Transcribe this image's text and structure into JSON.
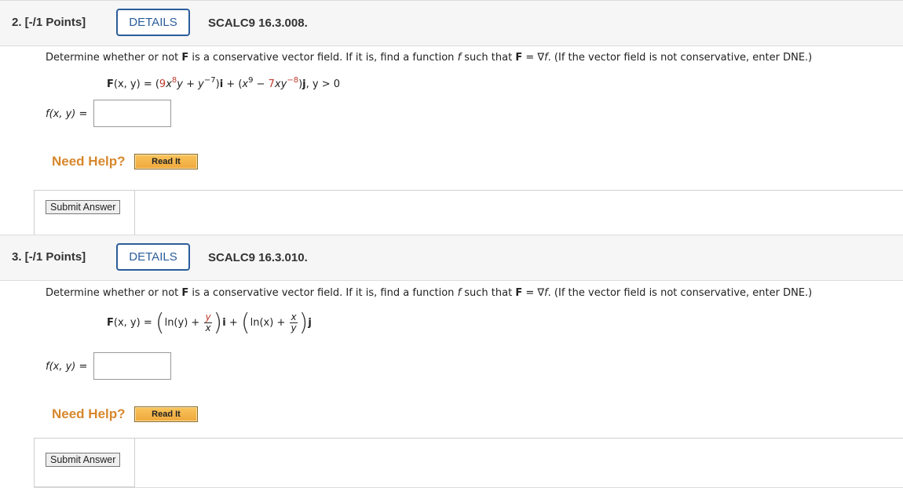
{
  "q2": {
    "num": "2.  [-/1 Points]",
    "details": "DETAILS",
    "code": "SCALC9 16.3.008.",
    "prompt": {
      "p1": "Determine whether or not ",
      "F": "F",
      "p2": " is a conservative vector field. If it is, find a function ",
      "f": "f",
      "p3": " such that ",
      "F2": "F",
      "p4": " = ∇",
      "f2": "f",
      "p5": ". (If the vector field is not conservative, enter DNE.)"
    },
    "eq": {
      "Fb": "F",
      "xy": "(x, y)",
      "eqs": " = (",
      "c9": "9",
      "x1": "x",
      "e8": "8",
      "y1": "y",
      "plus": " + ",
      "y2": "y",
      "em7": "−7",
      "close_i": ")",
      "ib": "i",
      "plus2": " + (",
      "x2": "x",
      "e9": "9",
      "minus": " − ",
      "c7": "7",
      "xy2": "xy",
      "em8": "−8",
      "close_j": ")",
      "jb": "j",
      "cond": ",   y > 0"
    },
    "flabel": "f(x, y)  =",
    "answer": "",
    "need_help": "Need Help?",
    "read_it": "Read It",
    "submit": "Submit Answer"
  },
  "q3": {
    "num": "3.  [-/1 Points]",
    "details": "DETAILS",
    "code": "SCALC9 16.3.010.",
    "prompt": {
      "p1": "Determine whether or not ",
      "F": "F",
      "p2": " is a conservative vector field. If it is, find a function ",
      "f": "f",
      "p3": " such that ",
      "F2": "F",
      "p4": " = ∇",
      "f2": "f",
      "p5": ". (If the vector field is not conservative, enter DNE.)"
    },
    "eq": {
      "Fb": "F",
      "xy": "(x, y)",
      "eqs": " = ",
      "ln1": "ln(y) + ",
      "num1": "y",
      "den1": "x",
      "ib": "i",
      "plus": " + ",
      "ln2": "ln(x) + ",
      "num2": "x",
      "den2": "y",
      "jb": "j"
    },
    "flabel": "f(x, y)  =",
    "answer": "",
    "need_help": "Need Help?",
    "read_it": "Read It",
    "submit": "Submit Answer"
  }
}
